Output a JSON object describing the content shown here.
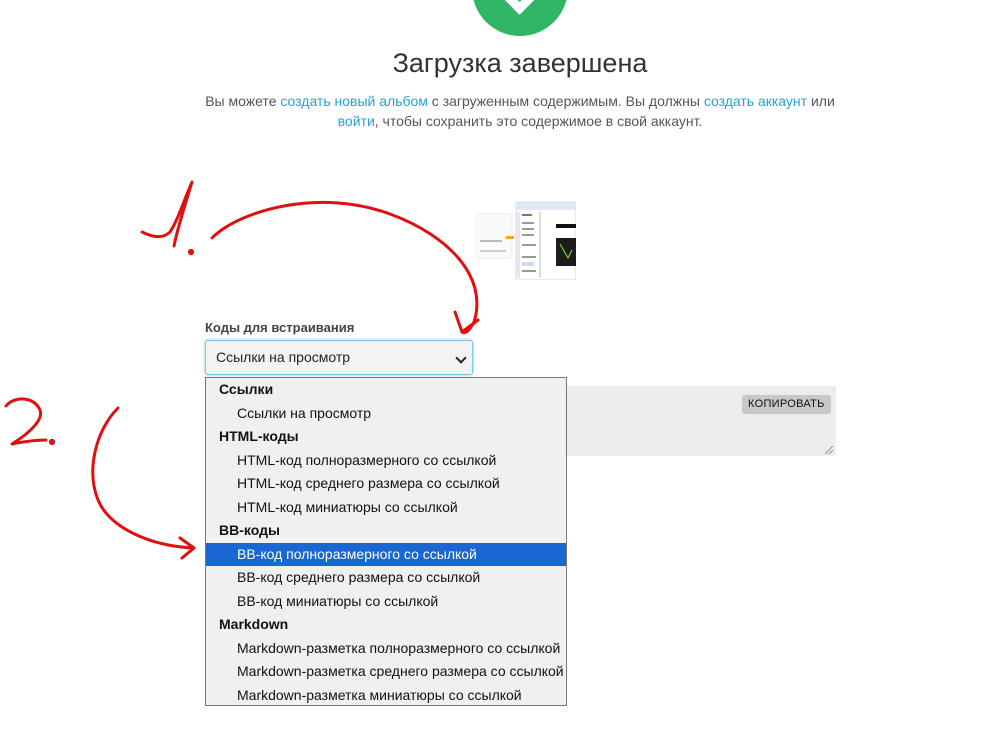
{
  "header": {
    "title": "Загрузка завершена",
    "desc_part1": "Вы можете ",
    "link_album": "создать новый альбом",
    "desc_part2": " с загруженным содержимым. Вы должны ",
    "link_account": "создать аккаунт",
    "desc_part3": " или ",
    "link_login": "войти",
    "desc_part4": ", чтобы сохранить это содержимое в свой аккаунт."
  },
  "embed": {
    "label": "Коды для встраивания",
    "selected_value": "Ссылки на просмотр",
    "copy_label": "КОПИРОВАТЬ"
  },
  "dropdown": {
    "groups": [
      {
        "label": "Ссылки",
        "options": [
          "Ссылки на просмотр"
        ]
      },
      {
        "label": "HTML-коды",
        "options": [
          "HTML-код полноразмерного со ссылкой",
          "HTML-код среднего размера со ссылкой",
          "HTML-код миниатюры со ссылкой"
        ]
      },
      {
        "label": "BB-коды",
        "options": [
          "BB-код полноразмерного со ссылкой",
          "BB-код среднего размера со ссылкой",
          "BB-код миниатюры со ссылкой"
        ]
      },
      {
        "label": "Markdown",
        "options": [
          "Markdown-разметка полноразмерного со ссылкой",
          "Markdown-разметка среднего размера со ссылкой",
          "Markdown-разметка миниатюры со ссылкой"
        ]
      }
    ],
    "highlighted_option": "BB-код полноразмерного со ссылкой"
  },
  "colors": {
    "success": "#2fb565",
    "link": "#2a9fd6",
    "highlight": "#1967d2",
    "annotation": "#e01010"
  },
  "icons": {
    "status": "check-circle-icon",
    "select": "chevron-down-icon"
  }
}
